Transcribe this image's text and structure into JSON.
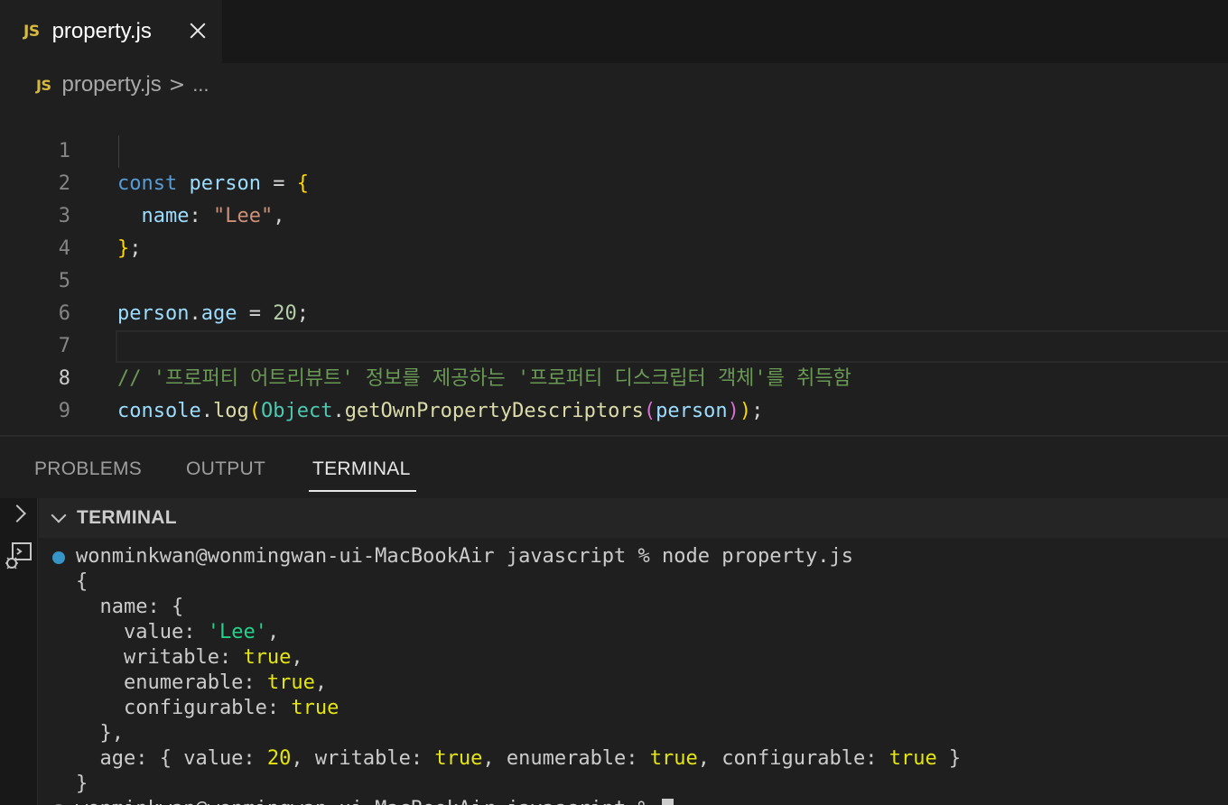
{
  "tab": {
    "badge": "JS",
    "title": "property.js"
  },
  "breadcrumb": {
    "badge": "JS",
    "file": "property.js",
    "separator": ">",
    "more": "..."
  },
  "editor": {
    "line_numbers": [
      "1",
      "2",
      "3",
      "4",
      "5",
      "6",
      "7",
      "8",
      "9"
    ],
    "active_line": 8,
    "lines": {
      "l1": {
        "kw": "const",
        "var": "person",
        "op": " = ",
        "br": "{"
      },
      "l2": {
        "prop": "name",
        "colon": ": ",
        "str": "\"Lee\"",
        "comma": ","
      },
      "l3": {
        "br": "}",
        "semi": ";"
      },
      "l5": {
        "obj": "person",
        "dot": ".",
        "prop": "age",
        "op": " = ",
        "num": "20",
        "semi": ";"
      },
      "l7": {
        "comment": "// '프로퍼티 어트리뷰트' 정보를 제공하는 '프로퍼티 디스크립터 객체'를 취득함"
      },
      "l8": {
        "obj": "console",
        "dot": ".",
        "fn": "log",
        "p1": "(",
        "cls": "Object",
        "dot2": ".",
        "fn2": "getOwnPropertyDescriptors",
        "p2": "(",
        "arg": "person",
        "p2c": ")",
        "p1c": ")",
        "semi": ";"
      }
    }
  },
  "panel": {
    "tabs": [
      "PROBLEMS",
      "OUTPUT",
      "TERMINAL"
    ],
    "active_tab": "TERMINAL",
    "section_title": "TERMINAL"
  },
  "terminal": {
    "prompt_line": "wonminkwan@wonmingwan-ui-MacBookAir javascript % node property.js",
    "output": {
      "open": "{",
      "name_open": "  name: {",
      "value_key": "    value: ",
      "value_val": "'Lee'",
      "value_comma": ",",
      "writable_key": "    writable: ",
      "writable_val": "true",
      "enumerable_key": "    enumerable: ",
      "enumerable_val": "true",
      "configurable_key": "    configurable: ",
      "configurable_val": "true",
      "name_close": "  },",
      "age_a": "  age: { value: ",
      "age_value": "20",
      "age_b": ", writable: ",
      "age_writable": "true",
      "age_c": ", enumerable: ",
      "age_enumerable": "true",
      "age_d": ", configurable: ",
      "age_configurable": "true",
      "age_e": " }",
      "close": "}"
    },
    "next_prompt": "wonminkwan@wonmingwan-ui-MacBookAir javascript % "
  },
  "colors": {
    "keyword": "#569cd6",
    "variable": "#9cdcfe",
    "string": "#ce9178",
    "number": "#b5cea8",
    "comment": "#6a9955",
    "function": "#dcdcaa",
    "class": "#4ec9b0",
    "bracket": "#ffd700",
    "js_badge": "#d7ba3b"
  }
}
